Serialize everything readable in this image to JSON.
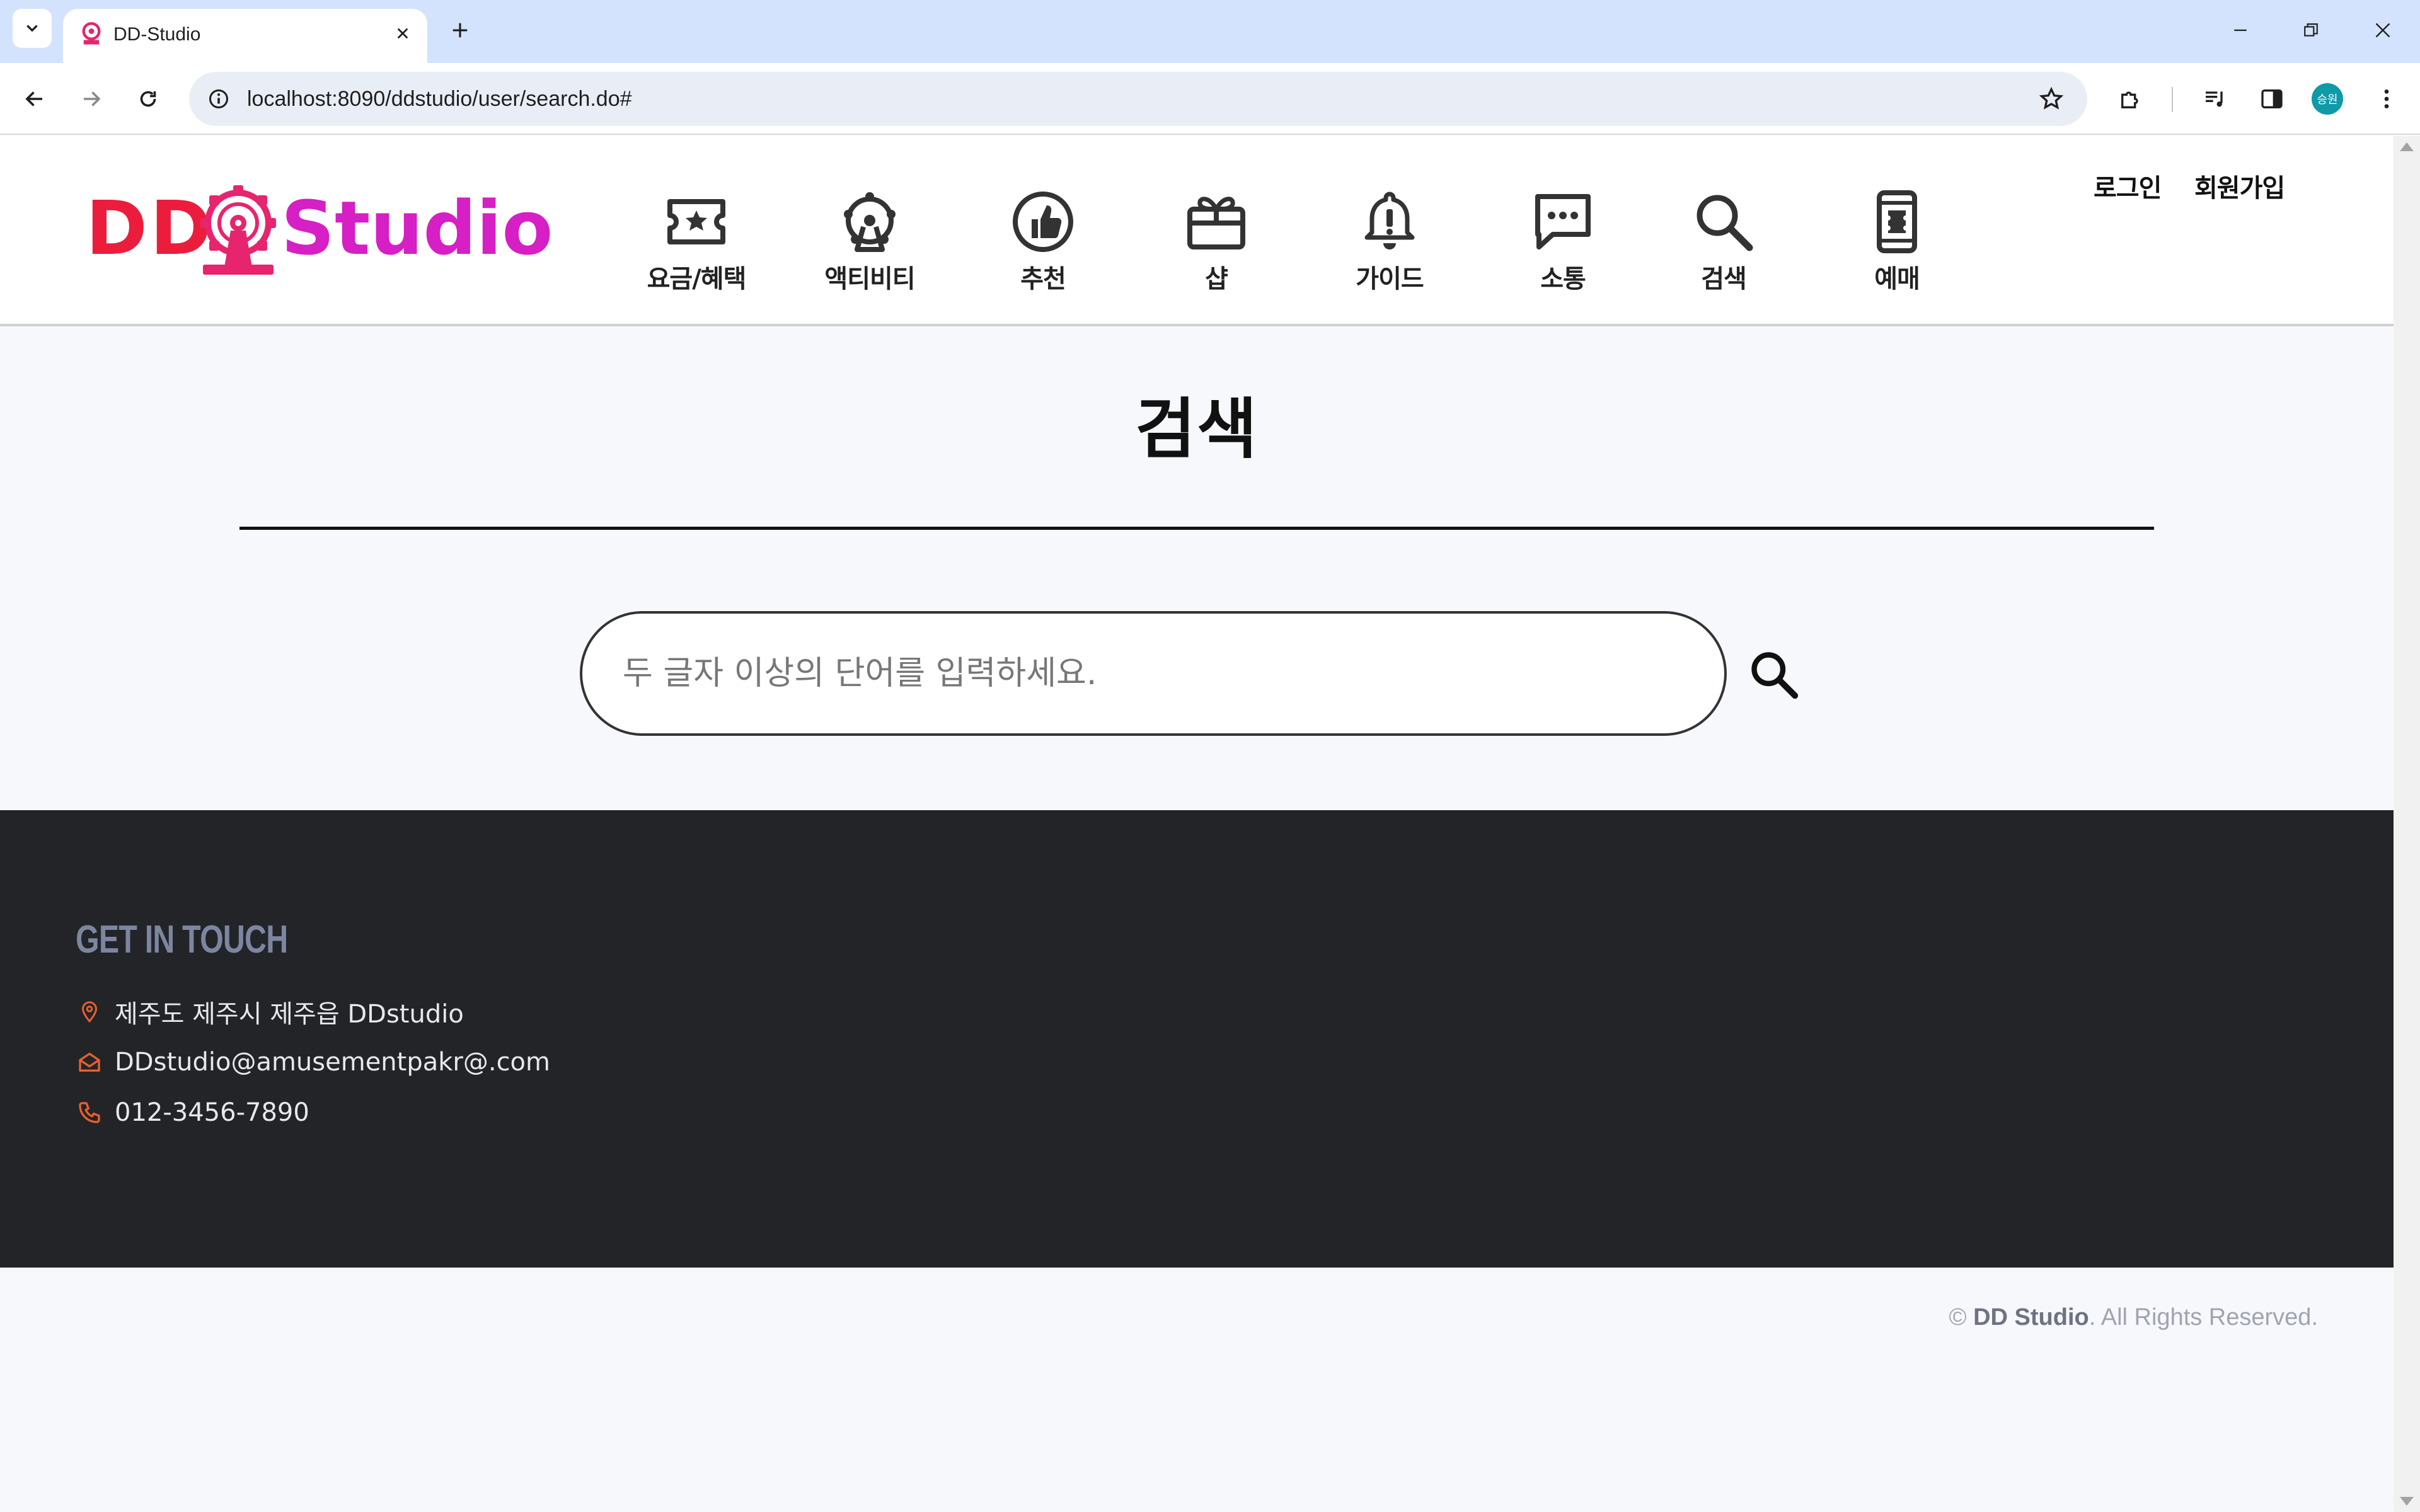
{
  "browser": {
    "tab_title": "DD-Studio",
    "url": "localhost:8090/ddstudio/user/search.do#",
    "profile_initials": "승원"
  },
  "header": {
    "logo_dd": "DD",
    "logo_studio": "Studio",
    "nav": [
      {
        "label": "요금/혜택",
        "icon": "ticket-star-icon"
      },
      {
        "label": "액티비티",
        "icon": "ferris-wheel-icon"
      },
      {
        "label": "추천",
        "icon": "thumbs-up-icon"
      },
      {
        "label": "샵",
        "icon": "gift-card-icon"
      },
      {
        "label": "가이드",
        "icon": "bell-alert-icon"
      },
      {
        "label": "소통",
        "icon": "chat-bubble-icon"
      },
      {
        "label": "검색",
        "icon": "search-icon"
      },
      {
        "label": "예매",
        "icon": "mobile-ticket-icon"
      }
    ],
    "login": "로그인",
    "signup": "회원가입"
  },
  "main": {
    "title": "검색",
    "search_placeholder": "두 글자 이상의 단어를 입력하세요.",
    "search_value": ""
  },
  "footer": {
    "heading": "GET IN TOUCH",
    "address": "제주도 제주시 제주읍 DDstudio",
    "email": "DDstudio@amusementpakr@.com",
    "phone": "012-3456-7890",
    "icon_color": "#e8612c"
  },
  "copyright": {
    "symbol": "©",
    "brand": "DD Studio",
    "rest": ". All Rights Reserved."
  },
  "colors": {
    "brand_red": "#ec1d3c",
    "brand_magenta": "#d61fc4",
    "footer_bg": "#232428",
    "page_bg": "#f7f8fc"
  }
}
